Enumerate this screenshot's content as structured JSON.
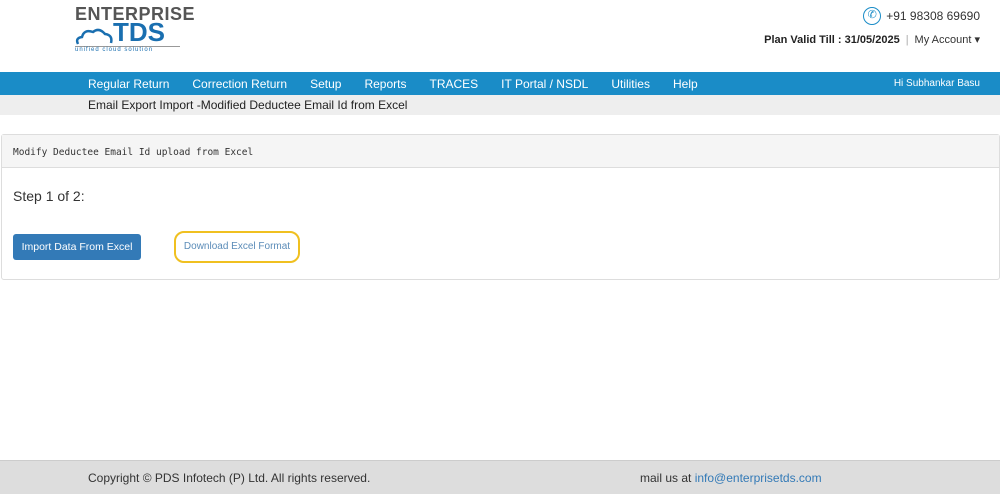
{
  "logo": {
    "line1": "ENTERPRISE",
    "line2": "TDS",
    "tagline": "unified cloud solution"
  },
  "header": {
    "phone": "+91 98308 69690",
    "plan_label": "Plan Valid Till : 31/05/2025",
    "separator": "|",
    "account": "My Account",
    "caret": "▾"
  },
  "nav": {
    "items": [
      "Regular Return",
      "Correction Return",
      "Setup",
      "Reports",
      "TRACES",
      "IT Portal / NSDL",
      "Utilities",
      "Help"
    ],
    "greeting": "Hi Subhankar Basu"
  },
  "breadcrumb": "Email Export Import -Modified Deductee Email Id from Excel",
  "panel": {
    "title": "Modify Deductee Email Id upload from Excel",
    "step": "Step 1 of 2:",
    "import_button": "Import Data From Excel",
    "download_link": "Download Excel Format"
  },
  "footer": {
    "copyright": "Copyright © PDS Infotech (P) Ltd. All rights reserved.",
    "mail_prefix": "mail us at",
    "email": "info@enterprisetds.com"
  }
}
